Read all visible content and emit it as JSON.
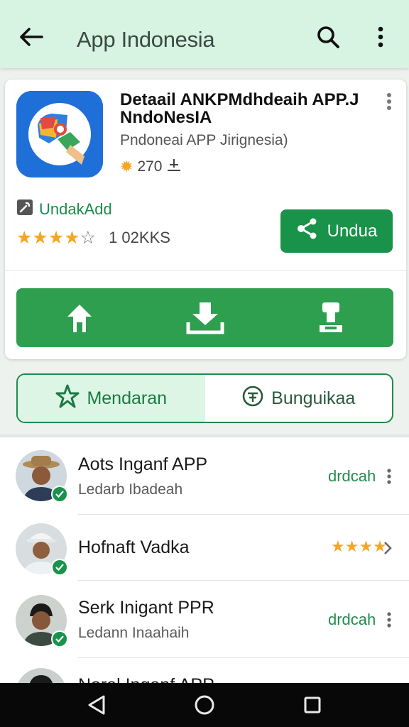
{
  "header": {
    "title": "App Indonesia"
  },
  "app": {
    "name": "Detaail ANKPMdhdeaih APP.J NndoNesIA",
    "subtitle": "Pndoneai APP Jirignesia)",
    "count": "270",
    "developer": "UndakAdd",
    "rating_value": 4,
    "rating_count": "1 02KKS",
    "install_label": "Undua"
  },
  "tabs": {
    "active": "Mendaran",
    "inactive": "Bunguikaa"
  },
  "list": {
    "items": [
      {
        "name": "Aots Inganf APP",
        "sub": "Ledarb Ibadeah",
        "action": "drdcah"
      },
      {
        "name": "Hofnaft Vadka",
        "stars": "★★★★"
      },
      {
        "name": "Serk Inigant PPR",
        "sub": "Ledann Inaahaih",
        "action": "drdcah"
      },
      {
        "name": "Noral Inganf APP"
      }
    ]
  },
  "colors": {
    "accent": "#19924a",
    "header_bg": "#d7f3e1",
    "star": "#f5a623"
  }
}
